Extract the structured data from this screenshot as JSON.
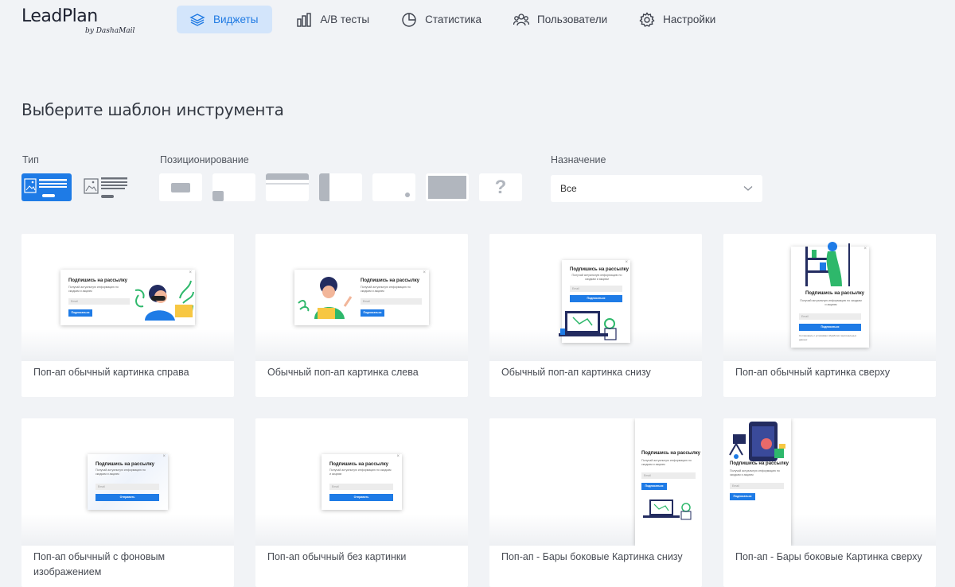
{
  "logo": {
    "main": "LeadPlan",
    "sub": "by DashaMail"
  },
  "nav": [
    {
      "label": "Виджеты",
      "icon": "layers-icon",
      "active": true
    },
    {
      "label": "A/B тесты",
      "icon": "bar-chart-icon"
    },
    {
      "label": "Статистика",
      "icon": "pie-chart-icon"
    },
    {
      "label": "Пользователи",
      "icon": "users-icon"
    },
    {
      "label": "Настройки",
      "icon": "gear-icon"
    }
  ],
  "page_title": "Выберите шаблон инструмента",
  "filters": {
    "type_label": "Тип",
    "position_label": "Позиционирование",
    "purpose_label": "Назначение",
    "purpose_value": "Все",
    "position_question": "?"
  },
  "popup": {
    "title": "Подпишись на рассылку",
    "desc": "Получай актуальную информацию по скидкам и акциям",
    "email": "Email",
    "subscribe": "Подписаться",
    "send": "Отправить",
    "consent": "Соглашаюсь с условиями обработки персональных данных"
  },
  "cards": [
    {
      "label": "Поп-ап обычный картинка справа"
    },
    {
      "label": "Обычный поп-ап картинка слева"
    },
    {
      "label": "Обычный поп-ап картинка снизу"
    },
    {
      "label": "Поп-ап обычный картинка сверху"
    },
    {
      "label": "Поп-ап обычный с фоновым изображением"
    },
    {
      "label": "Поп-ап обычный без картинки"
    },
    {
      "label": "Поп-ап - Бары боковые Картинка снизу"
    },
    {
      "label": "Поп-ап - Бары боковые Картинка сверху"
    }
  ],
  "colors": {
    "accent": "#1e7be6",
    "nav_active_bg": "#d3e5fb",
    "page_bg": "#f1f3f6"
  }
}
